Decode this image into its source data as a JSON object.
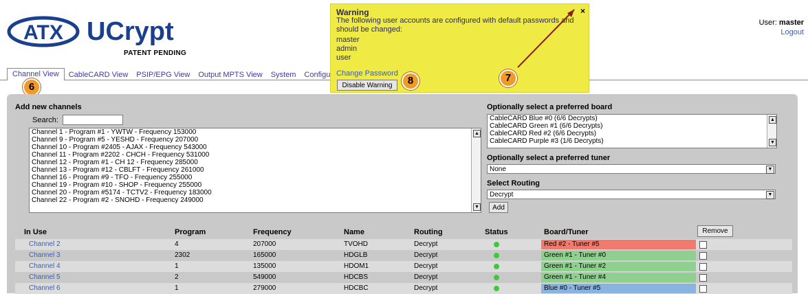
{
  "brand": {
    "logo_text_1": "ATX",
    "logo_text_2": "UCrypt",
    "patent": "PATENT PENDING"
  },
  "user": {
    "label": "User:",
    "name": "master",
    "logout": "Logout"
  },
  "tabs": [
    "Channel View",
    "CableCARD View",
    "PSIP/EPG View",
    "Output MPTS View",
    "System",
    "Configuration"
  ],
  "warning": {
    "title": "Warning",
    "message": "The following user accounts are configured with default passwords and should be changed:",
    "users": [
      "master",
      "admin",
      "user"
    ],
    "close": "×",
    "change_password": "Change Password",
    "disable_button": "Disable Warning"
  },
  "badges": {
    "b6": "6",
    "b7": "7",
    "b8": "8"
  },
  "add_channels": {
    "heading": "Add new channels",
    "search_label": "Search:",
    "search_value": "",
    "channels": [
      "Channel 1 - Program #1 - YWTW - Frequency 153000",
      "Channel 9 - Program #5 - YESHD - Frequency 207000",
      "Channel 10 - Program #2405 - AJAX - Frequency 543000",
      "Channel 11 - Program #2202 - CHCH - Frequency 531000",
      "Channel 12 - Program #1 - CH 12 - Frequency 285000",
      "Channel 13 - Program #12 - CBLFT - Frequency 261000",
      "Channel 16 - Program #9 - TFO - Frequency 255000",
      "Channel 19 - Program #10 - SHOP - Frequency 255000",
      "Channel 20 - Program #5174 - TCTV2 - Frequency 183000",
      "Channel 22 - Program #2 - SNOHD - Frequency 249000"
    ]
  },
  "board": {
    "heading": "Optionally select a preferred board",
    "options": [
      "CableCARD Blue #0 (6/6 Decrypts)",
      "CableCARD Green #1 (6/6 Decrypts)",
      "CableCARD Red #2 (6/6 Decrypts)",
      "CableCARD Purple #3 (1/6 Decrypts)"
    ]
  },
  "tuner": {
    "heading": "Optionally select a preferred tuner",
    "value": "None"
  },
  "routing": {
    "heading": "Select Routing",
    "value": "Decrypt",
    "add_button": "Add"
  },
  "table": {
    "headers": [
      "In Use",
      "Program",
      "Frequency",
      "Name",
      "Routing",
      "Status",
      "Board/Tuner"
    ],
    "remove_button": "Remove",
    "rows": [
      {
        "channel": "Channel 2",
        "program": "4",
        "frequency": "207000",
        "name": "TVOHD",
        "routing": "Decrypt",
        "board": "Red #2 - Tuner #5",
        "color": "#f07a6e"
      },
      {
        "channel": "Channel 3",
        "program": "2302",
        "frequency": "165000",
        "name": "HDGLB",
        "routing": "Decrypt",
        "board": "Green #1 - Tuner #0",
        "color": "#8fcf8f"
      },
      {
        "channel": "Channel 4",
        "program": "1",
        "frequency": "135000",
        "name": "HDOM1",
        "routing": "Decrypt",
        "board": "Green #1 - Tuner #2",
        "color": "#8fcf8f"
      },
      {
        "channel": "Channel 5",
        "program": "2",
        "frequency": "549000",
        "name": "HDCBS",
        "routing": "Decrypt",
        "board": "Green #1 - Tuner #4",
        "color": "#8fcf8f"
      },
      {
        "channel": "Channel 6",
        "program": "1",
        "frequency": "279000",
        "name": "HDCBC",
        "routing": "Decrypt",
        "board": "Blue #0 - Tuner #5",
        "color": "#8ab4e0"
      }
    ]
  }
}
